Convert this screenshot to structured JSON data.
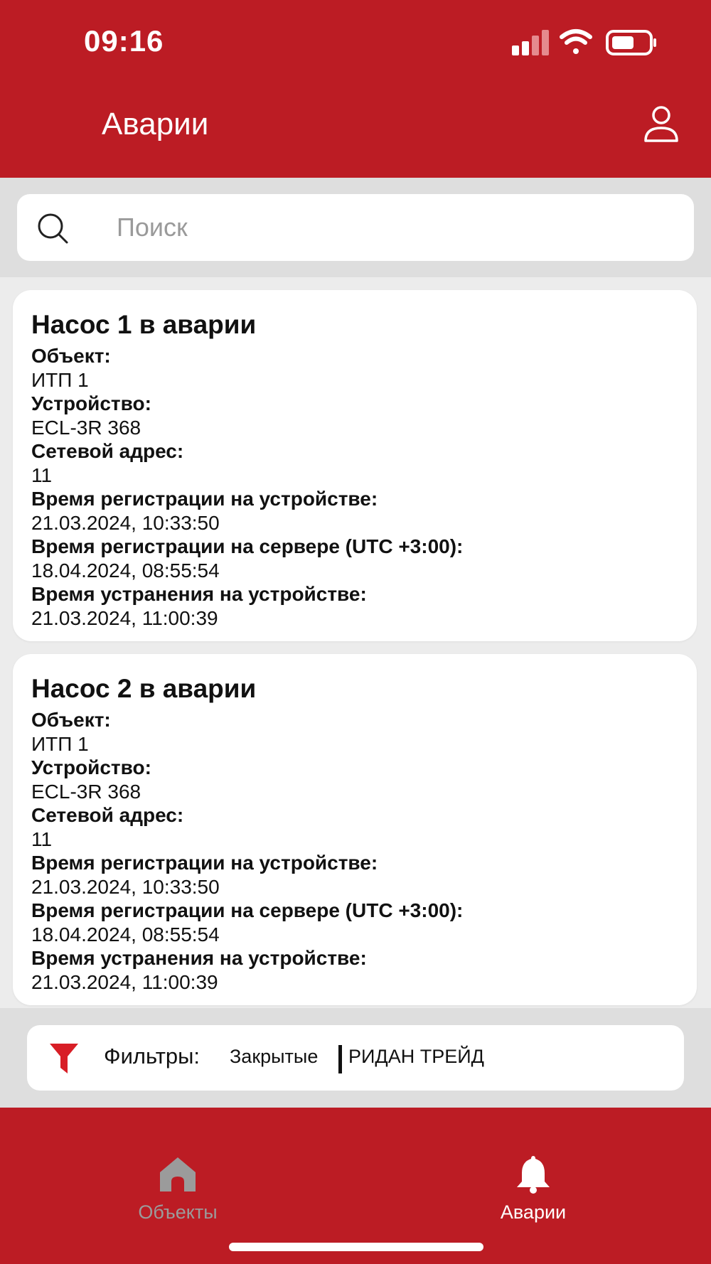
{
  "status_bar": {
    "time": "09:16"
  },
  "header": {
    "title": "Аварии"
  },
  "search": {
    "placeholder": "Поиск",
    "value": ""
  },
  "alarms": [
    {
      "title": "Насос 1 в аварии",
      "fields": [
        {
          "label": "Объект:",
          "value": "ИТП 1"
        },
        {
          "label": "Устройство:",
          "value": "ECL-3R 368"
        },
        {
          "label": "Сетевой адрес:",
          "value": "11"
        },
        {
          "label": "Время регистрации на устройстве:",
          "value": "21.03.2024, 10:33:50"
        },
        {
          "label": "Время регистрации на сервере (UTC +3:00):",
          "value": "18.04.2024, 08:55:54"
        },
        {
          "label": "Время устранения на устройстве:",
          "value": "21.03.2024, 11:00:39"
        }
      ]
    },
    {
      "title": "Насос 2 в аварии",
      "fields": [
        {
          "label": "Объект:",
          "value": "ИТП 1"
        },
        {
          "label": "Устройство:",
          "value": "ECL-3R 368"
        },
        {
          "label": "Сетевой адрес:",
          "value": "11"
        },
        {
          "label": "Время регистрации на устройстве:",
          "value": "21.03.2024, 10:33:50"
        },
        {
          "label": "Время регистрации на сервере (UTC +3:00):",
          "value": "18.04.2024, 08:55:54"
        },
        {
          "label": "Время устранения на устройстве:",
          "value": "21.03.2024, 11:00:39"
        }
      ]
    }
  ],
  "filters": {
    "label": "Фильтры:",
    "chips": [
      "Закрытые",
      "РИДАН ТРЕЙД"
    ]
  },
  "tabbar": {
    "tabs": [
      {
        "label": "Объекты",
        "icon": "home-icon",
        "active": false
      },
      {
        "label": "Аварии",
        "icon": "bell-icon",
        "active": true
      }
    ]
  },
  "colors": {
    "brand": "#bc1c24",
    "inactive_tab": "#9b9b9b",
    "background": "#ececec"
  }
}
